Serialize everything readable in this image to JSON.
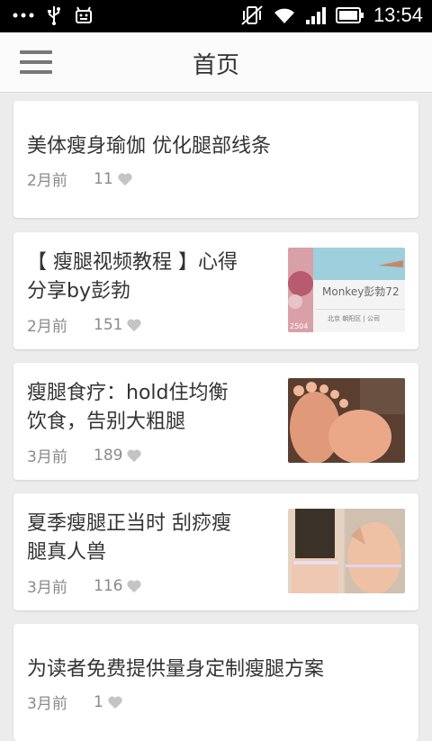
{
  "status_bar": {
    "time": "13:54",
    "icons": [
      "more-dots-icon",
      "usb-icon",
      "android-debug-icon",
      "vibrate-off-icon",
      "wifi-icon",
      "signal-icon",
      "battery-icon"
    ]
  },
  "header": {
    "title": "首页",
    "menu_icon": "hamburger-menu-icon"
  },
  "articles": [
    {
      "title": "美体瘦身瑜伽 优化腿部线条",
      "age": "2月前",
      "likes": "11",
      "has_thumbnail": false
    },
    {
      "title": "【 瘦腿视频教程 】心得分享by彭勃",
      "title_lines": [
        "【 瘦腿视频教程 】心得",
        "分享by彭勃"
      ],
      "age": "2月前",
      "likes": "151",
      "has_thumbnail": true,
      "thumb_text": [
        "Monkey彭勃72",
        "北京 朝阳区 | 公司",
        "2504"
      ]
    },
    {
      "title": "瘦腿食疗：hold住均衡饮食，告别大粗腿",
      "title_lines": [
        "瘦腿食疗：hold住均衡",
        "饮食，告别大粗腿"
      ],
      "age": "3月前",
      "likes": "189",
      "has_thumbnail": true
    },
    {
      "title": "夏季瘦腿正当时 刮痧瘦腿真人兽",
      "title_lines": [
        "夏季瘦腿正当时 刮痧瘦",
        "腿真人兽"
      ],
      "age": "3月前",
      "likes": "116",
      "has_thumbnail": true
    },
    {
      "title": "为读者免费提供量身定制瘦腿方案",
      "age": "3月前",
      "likes": "1",
      "has_thumbnail": false
    }
  ],
  "colors": {
    "background": "#ececec",
    "card": "#ffffff",
    "title_text": "#333333",
    "meta_text": "#8a8a8a",
    "heart": "#c4c4c4",
    "status_bar": "#000000"
  }
}
